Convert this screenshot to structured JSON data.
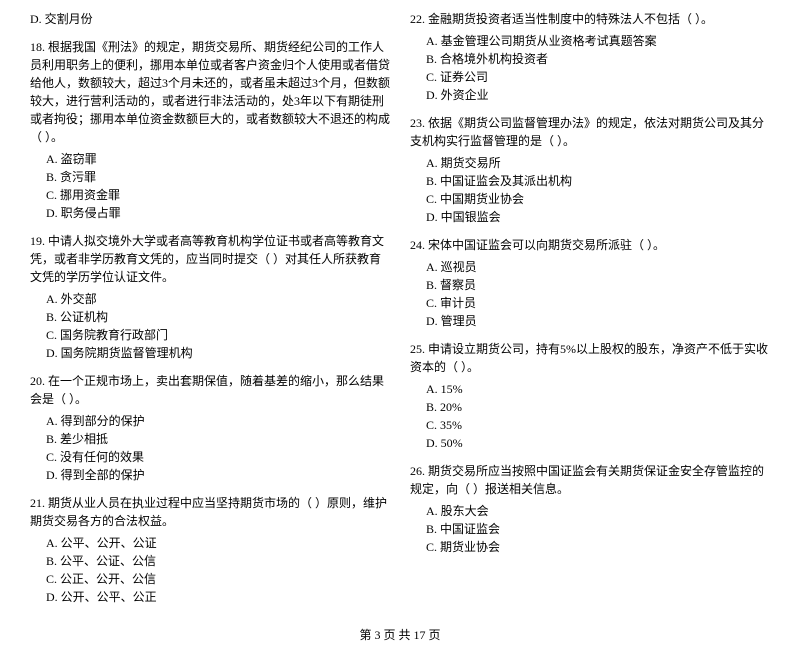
{
  "footer": "第 3 页 共 17 页",
  "left_column": {
    "questions": [
      {
        "id": "q_d",
        "title": "D. 交割月份",
        "options": []
      },
      {
        "id": "q18",
        "title": "18. 根据我国《刑法》的规定，期货交易所、期货经纪公司的工作人员利用职务上的便利，挪用本单位或者客户资金归个人使用或者借贷给他人，数额较大，超过3个月未还的，或者虽未超过3个月，但数额较大，进行营利活动的，或者进行非法活动的，处3年以下有期徒刑或者拘役；挪用本单位资金数额巨大的，或者数额较大不退还的构成（    ）。",
        "options": [
          {
            "label": "A.",
            "text": "盗窃罪"
          },
          {
            "label": "B.",
            "text": "贪污罪"
          },
          {
            "label": "C.",
            "text": "挪用资金罪"
          },
          {
            "label": "D.",
            "text": "职务侵占罪"
          }
        ]
      },
      {
        "id": "q19",
        "title": "19. 中请人拟交境外大学或者高等教育机构学位证书或者高等教育文凭，或者非学历教育文凭的，应当同时提交（    ）对其任人所获教育文凭的学历学位认证文件。",
        "options": [
          {
            "label": "A.",
            "text": "外交部"
          },
          {
            "label": "B.",
            "text": "公证机构"
          },
          {
            "label": "C.",
            "text": "国务院教育行政部门"
          },
          {
            "label": "D.",
            "text": "国务院期货监督管理机构"
          }
        ]
      },
      {
        "id": "q20",
        "title": "20. 在一个正规市场上，卖出套期保值，随着基差的缩小，那么结果会是（    ）。",
        "options": [
          {
            "label": "A.",
            "text": "得到部分的保护"
          },
          {
            "label": "B.",
            "text": "差少相抵"
          },
          {
            "label": "C.",
            "text": "没有任何的效果"
          },
          {
            "label": "D.",
            "text": "得到全部的保护"
          }
        ]
      },
      {
        "id": "q21",
        "title": "21. 期货从业人员在执业过程中应当坚持期货市场的（    ）原则，维护期货交易各方的合法权益。",
        "options": [
          {
            "label": "A.",
            "text": "公平、公开、公证"
          },
          {
            "label": "B.",
            "text": "公平、公证、公信"
          },
          {
            "label": "C.",
            "text": "公正、公开、公信"
          },
          {
            "label": "D.",
            "text": "公开、公平、公正"
          }
        ]
      }
    ]
  },
  "right_column": {
    "questions": [
      {
        "id": "q22",
        "title": "22. 金融期货投资者适当性制度中的特殊法人不包括（    ）。",
        "options": [
          {
            "label": "A.",
            "text": "基金管理公司期货从业资格考试真题答案"
          },
          {
            "label": "B.",
            "text": "合格境外机构投资者"
          },
          {
            "label": "C.",
            "text": "证券公司"
          },
          {
            "label": "D.",
            "text": "外资企业"
          }
        ]
      },
      {
        "id": "q23",
        "title": "23. 依据《期货公司监督管理办法》的规定，依法对期货公司及其分支机构实行监督管理的是（    ）。",
        "options": [
          {
            "label": "A.",
            "text": "期货交易所"
          },
          {
            "label": "B.",
            "text": "中国证监会及其派出机构"
          },
          {
            "label": "C.",
            "text": "中国期货业协会"
          },
          {
            "label": "D.",
            "text": "中国银监会"
          }
        ]
      },
      {
        "id": "q24",
        "title": "24. 宋体中国证监会可以向期货交易所派驻（    ）。",
        "options": [
          {
            "label": "A.",
            "text": "巡视员"
          },
          {
            "label": "B.",
            "text": "督察员"
          },
          {
            "label": "C.",
            "text": "审计员"
          },
          {
            "label": "D.",
            "text": "管理员"
          }
        ]
      },
      {
        "id": "q25",
        "title": "25. 申请设立期货公司，持有5%以上股权的股东，净资产不低于实收资本的（    ）。",
        "options": [
          {
            "label": "A.",
            "text": "15%"
          },
          {
            "label": "B.",
            "text": "20%"
          },
          {
            "label": "C.",
            "text": "35%"
          },
          {
            "label": "D.",
            "text": "50%"
          }
        ]
      },
      {
        "id": "q26",
        "title": "26. 期货交易所应当按照中国证监会有关期货保证金安全存管监控的规定，向（    ）报送相关信息。",
        "options": [
          {
            "label": "A.",
            "text": "股东大会"
          },
          {
            "label": "B.",
            "text": "中国证监会"
          },
          {
            "label": "C.",
            "text": "期货业协会"
          }
        ]
      }
    ]
  }
}
